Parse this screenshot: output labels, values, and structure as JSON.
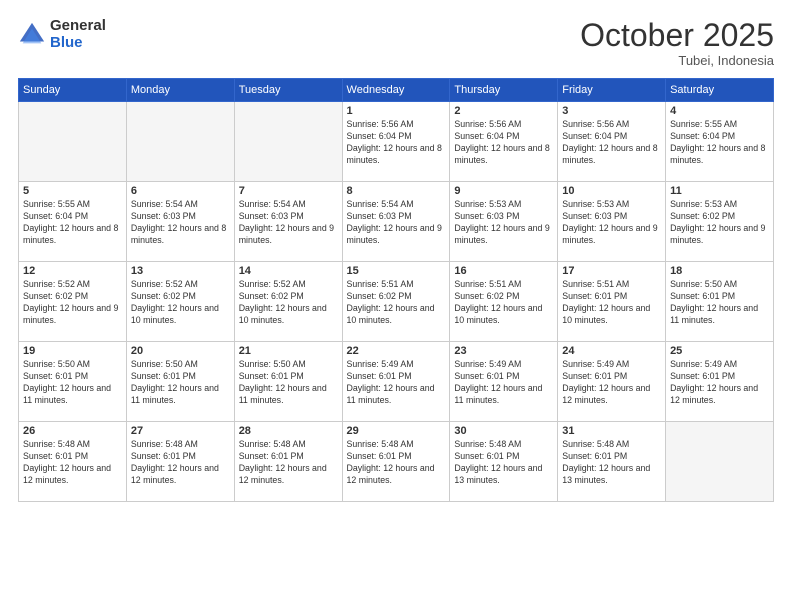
{
  "logo": {
    "general": "General",
    "blue": "Blue"
  },
  "header": {
    "month": "October 2025",
    "location": "Tubei, Indonesia"
  },
  "days_of_week": [
    "Sunday",
    "Monday",
    "Tuesday",
    "Wednesday",
    "Thursday",
    "Friday",
    "Saturday"
  ],
  "weeks": [
    [
      {
        "day": "",
        "info": ""
      },
      {
        "day": "",
        "info": ""
      },
      {
        "day": "",
        "info": ""
      },
      {
        "day": "1",
        "info": "Sunrise: 5:56 AM\nSunset: 6:04 PM\nDaylight: 12 hours\nand 8 minutes."
      },
      {
        "day": "2",
        "info": "Sunrise: 5:56 AM\nSunset: 6:04 PM\nDaylight: 12 hours\nand 8 minutes."
      },
      {
        "day": "3",
        "info": "Sunrise: 5:56 AM\nSunset: 6:04 PM\nDaylight: 12 hours\nand 8 minutes."
      },
      {
        "day": "4",
        "info": "Sunrise: 5:55 AM\nSunset: 6:04 PM\nDaylight: 12 hours\nand 8 minutes."
      }
    ],
    [
      {
        "day": "5",
        "info": "Sunrise: 5:55 AM\nSunset: 6:04 PM\nDaylight: 12 hours\nand 8 minutes."
      },
      {
        "day": "6",
        "info": "Sunrise: 5:54 AM\nSunset: 6:03 PM\nDaylight: 12 hours\nand 8 minutes."
      },
      {
        "day": "7",
        "info": "Sunrise: 5:54 AM\nSunset: 6:03 PM\nDaylight: 12 hours\nand 9 minutes."
      },
      {
        "day": "8",
        "info": "Sunrise: 5:54 AM\nSunset: 6:03 PM\nDaylight: 12 hours\nand 9 minutes."
      },
      {
        "day": "9",
        "info": "Sunrise: 5:53 AM\nSunset: 6:03 PM\nDaylight: 12 hours\nand 9 minutes."
      },
      {
        "day": "10",
        "info": "Sunrise: 5:53 AM\nSunset: 6:03 PM\nDaylight: 12 hours\nand 9 minutes."
      },
      {
        "day": "11",
        "info": "Sunrise: 5:53 AM\nSunset: 6:02 PM\nDaylight: 12 hours\nand 9 minutes."
      }
    ],
    [
      {
        "day": "12",
        "info": "Sunrise: 5:52 AM\nSunset: 6:02 PM\nDaylight: 12 hours\nand 9 minutes."
      },
      {
        "day": "13",
        "info": "Sunrise: 5:52 AM\nSunset: 6:02 PM\nDaylight: 12 hours\nand 10 minutes."
      },
      {
        "day": "14",
        "info": "Sunrise: 5:52 AM\nSunset: 6:02 PM\nDaylight: 12 hours\nand 10 minutes."
      },
      {
        "day": "15",
        "info": "Sunrise: 5:51 AM\nSunset: 6:02 PM\nDaylight: 12 hours\nand 10 minutes."
      },
      {
        "day": "16",
        "info": "Sunrise: 5:51 AM\nSunset: 6:02 PM\nDaylight: 12 hours\nand 10 minutes."
      },
      {
        "day": "17",
        "info": "Sunrise: 5:51 AM\nSunset: 6:01 PM\nDaylight: 12 hours\nand 10 minutes."
      },
      {
        "day": "18",
        "info": "Sunrise: 5:50 AM\nSunset: 6:01 PM\nDaylight: 12 hours\nand 11 minutes."
      }
    ],
    [
      {
        "day": "19",
        "info": "Sunrise: 5:50 AM\nSunset: 6:01 PM\nDaylight: 12 hours\nand 11 minutes."
      },
      {
        "day": "20",
        "info": "Sunrise: 5:50 AM\nSunset: 6:01 PM\nDaylight: 12 hours\nand 11 minutes."
      },
      {
        "day": "21",
        "info": "Sunrise: 5:50 AM\nSunset: 6:01 PM\nDaylight: 12 hours\nand 11 minutes."
      },
      {
        "day": "22",
        "info": "Sunrise: 5:49 AM\nSunset: 6:01 PM\nDaylight: 12 hours\nand 11 minutes."
      },
      {
        "day": "23",
        "info": "Sunrise: 5:49 AM\nSunset: 6:01 PM\nDaylight: 12 hours\nand 11 minutes."
      },
      {
        "day": "24",
        "info": "Sunrise: 5:49 AM\nSunset: 6:01 PM\nDaylight: 12 hours\nand 12 minutes."
      },
      {
        "day": "25",
        "info": "Sunrise: 5:49 AM\nSunset: 6:01 PM\nDaylight: 12 hours\nand 12 minutes."
      }
    ],
    [
      {
        "day": "26",
        "info": "Sunrise: 5:48 AM\nSunset: 6:01 PM\nDaylight: 12 hours\nand 12 minutes."
      },
      {
        "day": "27",
        "info": "Sunrise: 5:48 AM\nSunset: 6:01 PM\nDaylight: 12 hours\nand 12 minutes."
      },
      {
        "day": "28",
        "info": "Sunrise: 5:48 AM\nSunset: 6:01 PM\nDaylight: 12 hours\nand 12 minutes."
      },
      {
        "day": "29",
        "info": "Sunrise: 5:48 AM\nSunset: 6:01 PM\nDaylight: 12 hours\nand 12 minutes."
      },
      {
        "day": "30",
        "info": "Sunrise: 5:48 AM\nSunset: 6:01 PM\nDaylight: 12 hours\nand 13 minutes."
      },
      {
        "day": "31",
        "info": "Sunrise: 5:48 AM\nSunset: 6:01 PM\nDaylight: 12 hours\nand 13 minutes."
      },
      {
        "day": "",
        "info": ""
      }
    ]
  ]
}
